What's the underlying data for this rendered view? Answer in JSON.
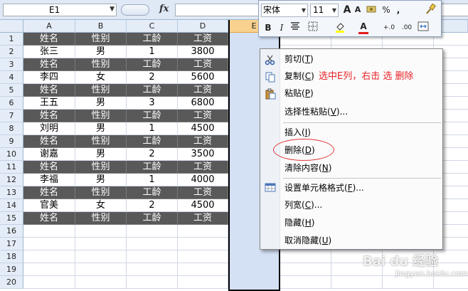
{
  "formula_bar": {
    "name_box": "E1",
    "fx_label": "fx",
    "formula": ""
  },
  "columns": [
    "A",
    "B",
    "C",
    "D",
    "E"
  ],
  "selected_column": "E",
  "rows": [
    {
      "num": "1",
      "cells": [
        "姓名",
        "性别",
        "工龄",
        "工资"
      ],
      "dark": true
    },
    {
      "num": "2",
      "cells": [
        "张三",
        "男",
        "1",
        "3800"
      ],
      "dark": false
    },
    {
      "num": "3",
      "cells": [
        "姓名",
        "性别",
        "工龄",
        "工资"
      ],
      "dark": true
    },
    {
      "num": "4",
      "cells": [
        "李四",
        "女",
        "2",
        "5600"
      ],
      "dark": false
    },
    {
      "num": "5",
      "cells": [
        "姓名",
        "性别",
        "工龄",
        "工资"
      ],
      "dark": true
    },
    {
      "num": "6",
      "cells": [
        "王五",
        "男",
        "3",
        "6800"
      ],
      "dark": false
    },
    {
      "num": "7",
      "cells": [
        "姓名",
        "性别",
        "工龄",
        "工资"
      ],
      "dark": true
    },
    {
      "num": "8",
      "cells": [
        "刘明",
        "男",
        "1",
        "4500"
      ],
      "dark": false
    },
    {
      "num": "9",
      "cells": [
        "姓名",
        "性别",
        "工龄",
        "工资"
      ],
      "dark": true
    },
    {
      "num": "10",
      "cells": [
        "谢嘉",
        "男",
        "2",
        "3500"
      ],
      "dark": false
    },
    {
      "num": "11",
      "cells": [
        "姓名",
        "性别",
        "工龄",
        "工资"
      ],
      "dark": true
    },
    {
      "num": "12",
      "cells": [
        "李福",
        "男",
        "1",
        "4000"
      ],
      "dark": false
    },
    {
      "num": "13",
      "cells": [
        "姓名",
        "性别",
        "工龄",
        "工资"
      ],
      "dark": true
    },
    {
      "num": "14",
      "cells": [
        "官美",
        "女",
        "2",
        "4500"
      ],
      "dark": false
    },
    {
      "num": "15",
      "cells": [
        "姓名",
        "性别",
        "工龄",
        "工资"
      ],
      "dark": true
    },
    {
      "num": "16",
      "cells": [
        "",
        "",
        "",
        ""
      ],
      "dark": false
    },
    {
      "num": "17",
      "cells": [
        "",
        "",
        "",
        ""
      ],
      "dark": false
    },
    {
      "num": "18",
      "cells": [
        "",
        "",
        "",
        ""
      ],
      "dark": false
    },
    {
      "num": "19",
      "cells": [
        "",
        "",
        "",
        ""
      ],
      "dark": false
    },
    {
      "num": "20",
      "cells": [
        "",
        "",
        "",
        ""
      ],
      "dark": false
    }
  ],
  "mini_toolbar": {
    "font_name": "宋体",
    "font_size": "11",
    "grow_font": "A",
    "shrink_font": "A",
    "percent": "%",
    "comma": ",",
    "bold": "B",
    "italic": "I",
    "font_color": "A",
    "inc_decimal": "+.0",
    "dec_decimal": ".00"
  },
  "context_menu": {
    "items": [
      {
        "label": "剪切",
        "key": "T",
        "icon": "scissors-icon"
      },
      {
        "label": "复制",
        "key": "C",
        "icon": "copy-icon"
      },
      {
        "label": "粘贴",
        "key": "P",
        "icon": "paste-icon"
      },
      {
        "label": "选择性粘贴",
        "key": "V",
        "suffix": "...",
        "icon": ""
      },
      {
        "label": "插入",
        "key": "I",
        "icon": ""
      },
      {
        "label": "删除",
        "key": "D",
        "icon": ""
      },
      {
        "label": "清除内容",
        "key": "N",
        "icon": ""
      },
      {
        "label": "设置单元格格式",
        "key": "F",
        "suffix": "...",
        "icon": "format-cells-icon"
      },
      {
        "label": "列宽",
        "key": "C",
        "suffix": "...",
        "icon": ""
      },
      {
        "label": "隐藏",
        "key": "H",
        "icon": ""
      },
      {
        "label": "取消隐藏",
        "key": "U",
        "icon": ""
      }
    ]
  },
  "annotation": "选中E列，右击 选 删除",
  "watermark": {
    "brand": "Bai du 经验",
    "url": "jingyan.baidu.com"
  },
  "colors": {
    "header_row": "#595959",
    "selected_column": "#d4e1f4",
    "annotation": "#e8262b"
  }
}
